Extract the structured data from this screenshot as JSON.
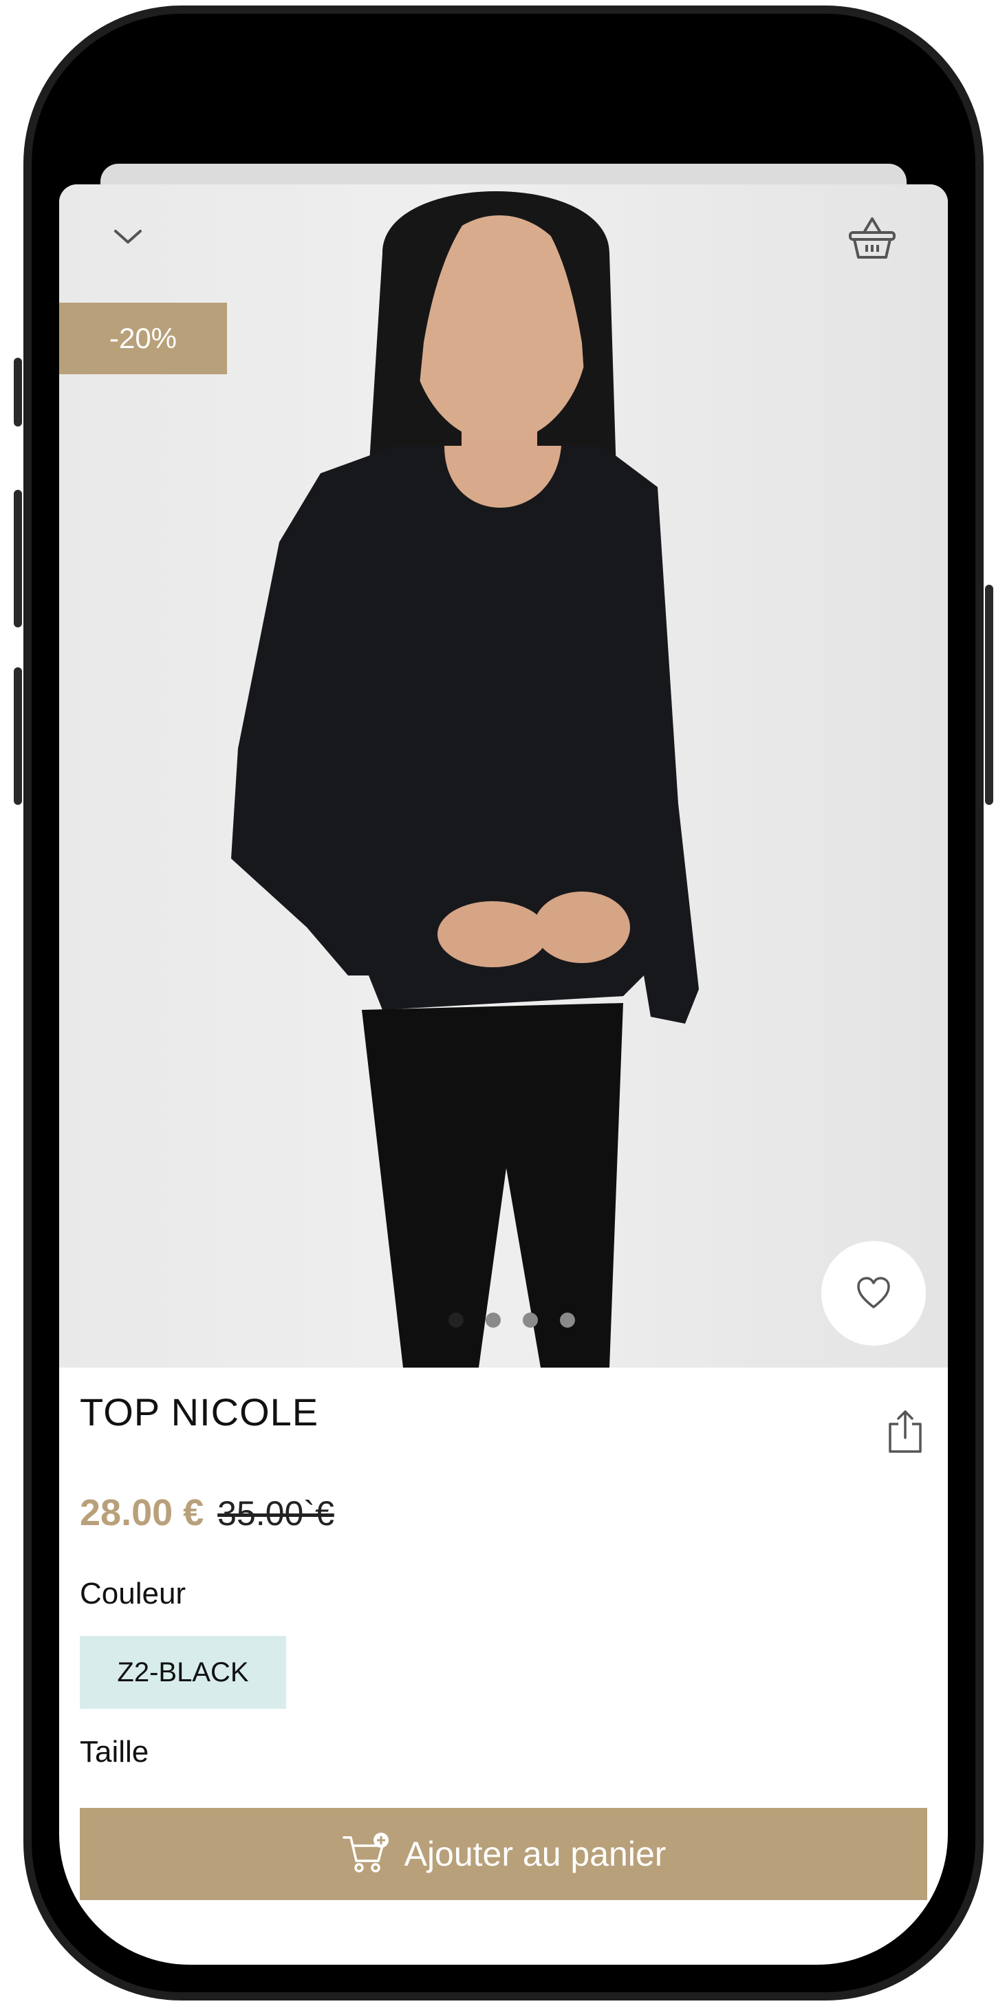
{
  "product": {
    "discount": "-20%",
    "name": "TOP NICOLE",
    "price_current": "28.00 €",
    "price_original": "35.00`€",
    "color_label": "Couleur",
    "color_value": "Z2-BLACK",
    "size_label": "Taille"
  },
  "carousel": {
    "count": 4,
    "active_index": 0
  },
  "actions": {
    "add_to_cart_label": "Ajouter au panier"
  },
  "icons": {
    "close": "chevron-down-icon",
    "cart": "basket-icon",
    "favorite": "heart-icon",
    "share": "share-icon",
    "add_to_cart": "cart-plus-icon"
  },
  "colors": {
    "accent": "#b8a07a",
    "chip_bg": "#d9ecec"
  }
}
